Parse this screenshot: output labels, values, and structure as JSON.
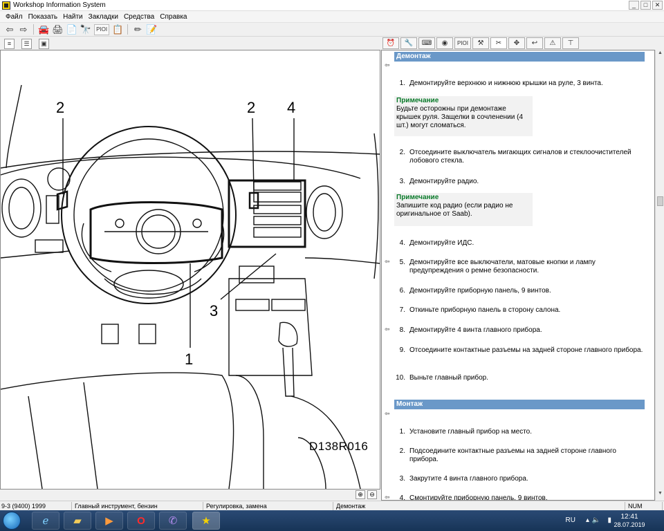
{
  "window": {
    "title": "Workshop Information System",
    "buttons": [
      "_",
      "□",
      "✕"
    ]
  },
  "menu": [
    "Файл",
    "Показать",
    "Найти",
    "Закладки",
    "Средства",
    "Справка"
  ],
  "toolbar": {
    "pioi_label": "PIOI"
  },
  "right_tabs": {
    "pioi_label": "PIOI"
  },
  "diagram": {
    "id": "D138R016",
    "callouts": [
      "2",
      "2",
      "4",
      "3",
      "1"
    ]
  },
  "sections": {
    "dismount": {
      "header": "Демонтаж",
      "steps": [
        {
          "num": "1.",
          "text": "Демонтируйте верхнюю и нижнюю крышки на руле, 3 винта."
        },
        {
          "num": "2.",
          "text": "Отсоедините выключатель мигающих сигналов и стеклоочистителей лобового стекла."
        },
        {
          "num": "3.",
          "text": "Демонтируйте радио."
        },
        {
          "num": "4.",
          "text": "Демонтируйте ИДС."
        },
        {
          "num": "5.",
          "text": "Демонтируйте все выключатели, матовые кнопки и лампу предупреждения о ремне безопасности."
        },
        {
          "num": "6.",
          "text": "Демонтируйте приборную панель, 9 винтов."
        },
        {
          "num": "7.",
          "text": "Откиньте приборную панель в сторону салона."
        },
        {
          "num": "8.",
          "text": "Демонтируйте 4 винта главного прибора."
        },
        {
          "num": "9.",
          "text": "Отсоедините контактные разъемы на задней стороне главного прибора."
        },
        {
          "num": "10.",
          "text": "Выньте главный прибор."
        }
      ],
      "notes": [
        {
          "title": "Примечание",
          "text": "Будьте осторожны при демонтаже крышек руля. Защелки в сочленении (4 шт.) могут сломаться."
        },
        {
          "title": "Примечание",
          "text": "Запишите код радио (если радио не оригинальное от Saab)."
        }
      ]
    },
    "mount": {
      "header": "Монтаж",
      "steps": [
        {
          "num": "1.",
          "text": "Установите главный прибор на место."
        },
        {
          "num": "2.",
          "text": "Подсоедините контактные разъемы на задней стороне главного прибора."
        },
        {
          "num": "3.",
          "text": "Закрутите 4 винта главного прибора."
        },
        {
          "num": "4.",
          "text": "Смонтируйте приборную панель, 9 винтов."
        }
      ]
    }
  },
  "statusbar": {
    "vehicle": "9-3 (9400) 1999",
    "component": "Главный инструмент, бензин",
    "category": "Регулировка, замена",
    "document": "Демонтаж",
    "num": "NUM"
  },
  "taskbar": {
    "lang": "RU",
    "time": "12:41",
    "date": "28.07.2019"
  },
  "colors": {
    "section_header": "#6a98c8",
    "note_title": "#0a7a2a"
  }
}
